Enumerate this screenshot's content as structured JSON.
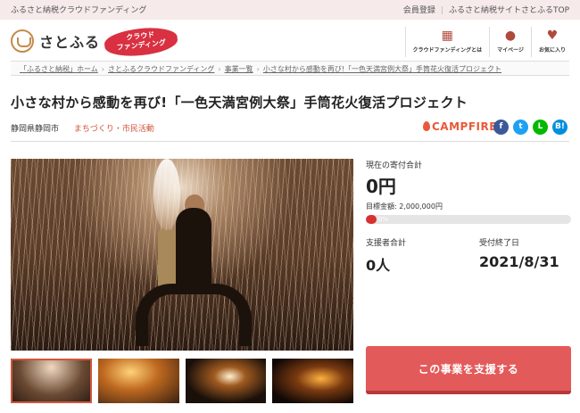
{
  "topbar": {
    "tagline": "ふるさと納税クラウドファンディング",
    "links": [
      "会員登録",
      "ふるさと納税サイトさとふるTOP"
    ]
  },
  "header": {
    "logo_text": "さとふる",
    "badge_line1": "クラウド",
    "badge_line2": "ファンディング",
    "nav": [
      {
        "label": "クラウドファンディングとは",
        "icon": "grid-icon"
      },
      {
        "label": "マイページ",
        "icon": "user-icon"
      },
      {
        "label": "お気に入り",
        "icon": "heart-icon"
      }
    ]
  },
  "breadcrumb": [
    "「ふるさと納税」ホーム",
    "さとふるクラウドファンディング",
    "事業一覧",
    "小さな村から感動を再び!「一色天満宮例大祭」手筒花火復活プロジェクト"
  ],
  "project": {
    "title": "小さな村から感動を再び!「一色天満宮例大祭」手筒花火復活プロジェクト",
    "location": "静岡県静岡市",
    "category": "まちづくり・市民活動",
    "partner": "CAMPFIRE"
  },
  "social": [
    "f",
    "t",
    "L",
    "B!"
  ],
  "funding": {
    "current_label": "現在の寄付合計",
    "current_amount": "0円",
    "goal_text": "目標金額: 2,000,000円",
    "progress_percent": 0,
    "progress_text": "0%",
    "supporters_label": "支援者合計",
    "supporters_value": "0人",
    "deadline_label": "受付終了日",
    "deadline_value": "2021/8/31"
  },
  "cta": {
    "label": "この事業を支援する"
  }
}
